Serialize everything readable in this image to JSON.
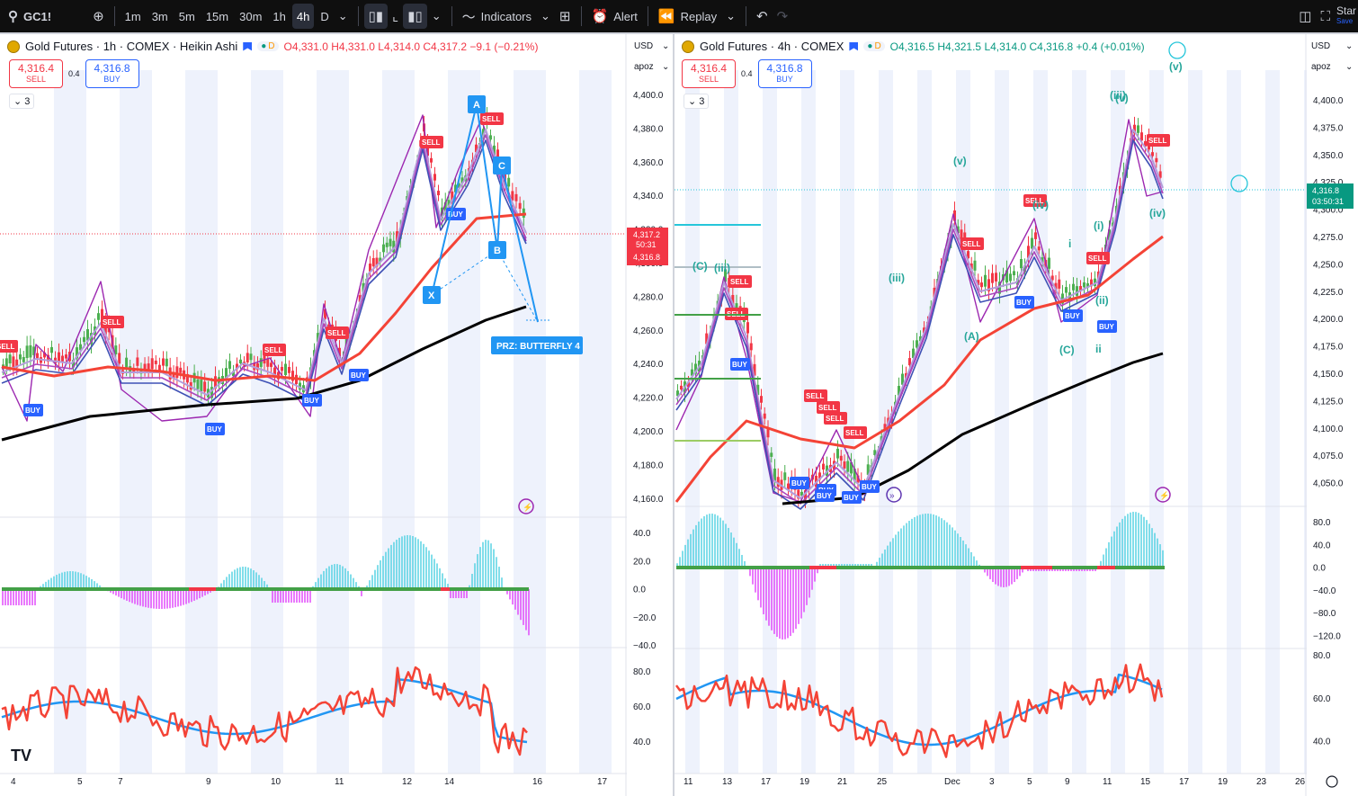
{
  "topbar": {
    "symbol": "GC1!",
    "intervals": [
      "1m",
      "3m",
      "5m",
      "15m",
      "30m",
      "1h",
      "4h",
      "D"
    ],
    "active_interval": "4h",
    "indicators_label": "Indicators",
    "alert_label": "Alert",
    "replay_label": "Replay",
    "start_label": "Star",
    "save_label": "Save"
  },
  "left": {
    "legend": {
      "title": "Gold Futures · 1h · COMEX · Heikin Ashi",
      "pill_d": "D",
      "o": "O4,331.0",
      "h": "H4,331.0",
      "l": "L4,314.0",
      "c": "C4,317.2",
      "chg": "−9.1 (−0.21%)"
    },
    "sell_price": "4,316.4",
    "sell_label": "SELL",
    "spread": "0.4",
    "buy_price": "4,316.8",
    "buy_label": "BUY",
    "collapse_label": "3",
    "currency": "USD",
    "scale_name": "apoz",
    "price_ticks": [
      "4,400.0",
      "4,380.0",
      "4,360.0",
      "4,340.0",
      "4,320.0",
      "4,300.0",
      "4,280.0",
      "4,260.0",
      "4,240.0",
      "4,220.0",
      "4,200.0",
      "4,180.0",
      "4,160.0"
    ],
    "osc_ticks": [
      "40.0",
      "20.0",
      "0.0",
      "−20.0",
      "−40.0"
    ],
    "rsi_ticks": [
      "80.0",
      "60.0",
      "40.0"
    ],
    "date_ticks": [
      "4",
      "5",
      "7",
      "9",
      "10",
      "11",
      "12",
      "14",
      "16",
      "17"
    ],
    "price_label_top": "4,317.2",
    "countdown": "50:31",
    "price_label_bottom": "4,316.8",
    "prz_label": "PRZ: BUTTERFLY 4",
    "pattern_points": [
      "X",
      "A",
      "B",
      "C"
    ],
    "tv_logo": "TV"
  },
  "right": {
    "legend": {
      "title": "Gold Futures · 4h · COMEX",
      "pill_d": "D",
      "o": "O4,316.5",
      "h": "H4,321.5",
      "l": "L4,314.0",
      "c": "C4,316.8",
      "chg": "+0.4 (+0.01%)"
    },
    "sell_price": "4,316.4",
    "sell_label": "SELL",
    "spread": "0.4",
    "buy_price": "4,316.8",
    "buy_label": "BUY",
    "collapse_label": "3",
    "currency": "USD",
    "scale_name": "apoz",
    "price_ticks": [
      "4,400.0",
      "4,375.0",
      "4,350.0",
      "4,325.0",
      "4,300.0",
      "4,275.0",
      "4,250.0",
      "4,225.0",
      "4,200.0",
      "4,175.0",
      "4,150.0",
      "4,125.0",
      "4,100.0",
      "4,075.0",
      "4,050.0"
    ],
    "osc_ticks": [
      "80.0",
      "40.0",
      "0.0",
      "−40.0",
      "−80.0",
      "−120.0"
    ],
    "rsi_ticks": [
      "80.0",
      "60.0",
      "40.0"
    ],
    "date_ticks": [
      "11",
      "13",
      "17",
      "19",
      "21",
      "25",
      "Dec",
      "3",
      "5",
      "9",
      "11",
      "15",
      "17",
      "19",
      "23",
      "26"
    ],
    "price_label": "4,316.8",
    "countdown": "03:50:31",
    "wave_labels": [
      "(iii)",
      "(v)",
      "(C)",
      "(iii)",
      "(v)",
      "(A)",
      "(iv)",
      "(v)",
      "(iii)",
      "(iv)",
      "(C)",
      "i",
      "(i)",
      "(ii)",
      "ii"
    ]
  },
  "labels": {
    "buy": "BUY",
    "sell": "SELL"
  }
}
